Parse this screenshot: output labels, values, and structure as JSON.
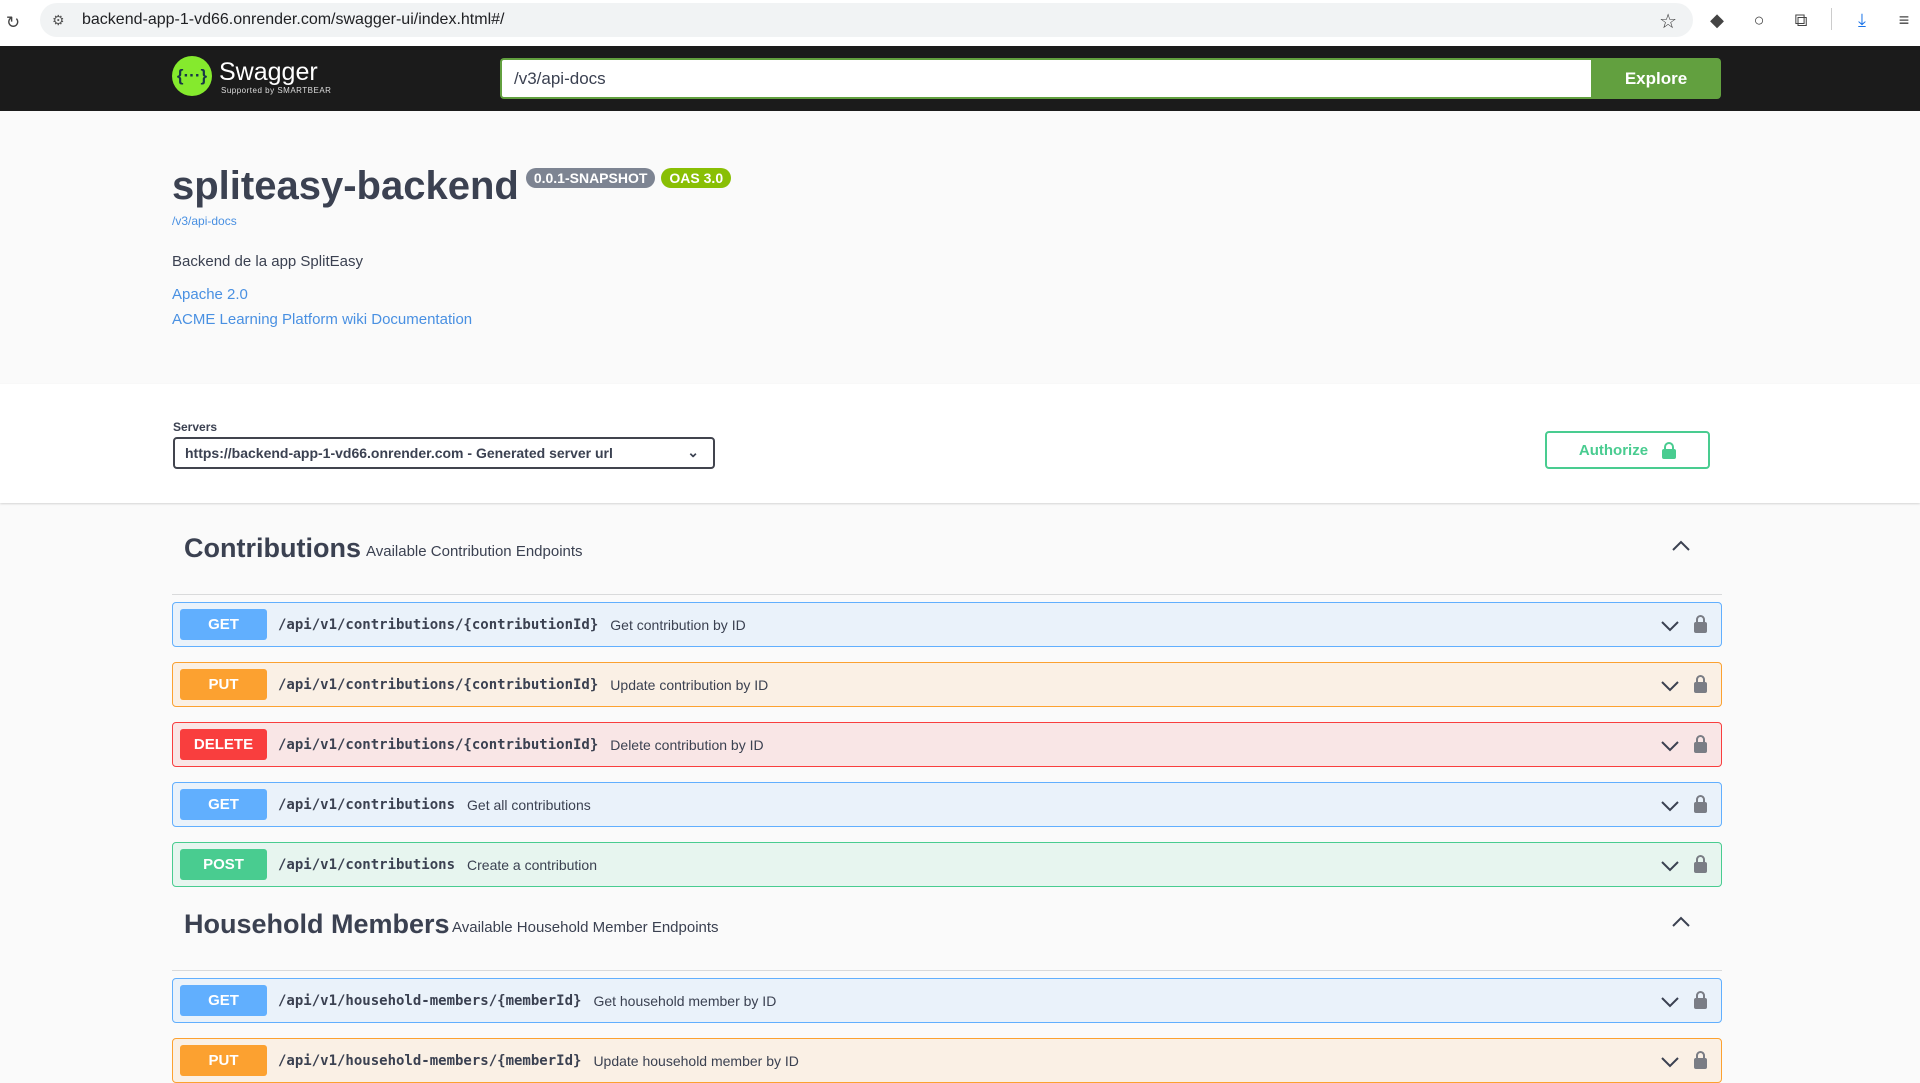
{
  "browser": {
    "url": "backend-app-1-vd66.onrender.com/swagger-ui/index.html#/"
  },
  "header": {
    "logo_title": "Swagger",
    "logo_sub": "Supported by SMARTBEAR",
    "search_value": "/v3/api-docs",
    "explore_label": "Explore"
  },
  "info": {
    "title": "spliteasy-backend",
    "version": "0.0.1-SNAPSHOT",
    "oas": "OAS 3.0",
    "api_link": "/v3/api-docs",
    "description": "Backend de la app SplitEasy",
    "license": "Apache 2.0",
    "docs_link": "ACME Learning Platform wiki Documentation"
  },
  "servers": {
    "label": "Servers",
    "selected": "https://backend-app-1-vd66.onrender.com - Generated server url",
    "authorize_label": "Authorize"
  },
  "sections": [
    {
      "title": "Contributions",
      "description": "Available Contribution Endpoints",
      "ops": [
        {
          "method": "GET",
          "path": "/api/v1/contributions/{contributionId}",
          "summary": "Get contribution by ID"
        },
        {
          "method": "PUT",
          "path": "/api/v1/contributions/{contributionId}",
          "summary": "Update contribution by ID"
        },
        {
          "method": "DELETE",
          "path": "/api/v1/contributions/{contributionId}",
          "summary": "Delete contribution by ID"
        },
        {
          "method": "GET",
          "path": "/api/v1/contributions",
          "summary": "Get all contributions"
        },
        {
          "method": "POST",
          "path": "/api/v1/contributions",
          "summary": "Create a contribution"
        }
      ]
    },
    {
      "title": "Household Members",
      "description": "Available Household Member Endpoints",
      "ops": [
        {
          "method": "GET",
          "path": "/api/v1/household-members/{memberId}",
          "summary": "Get household member by ID"
        },
        {
          "method": "PUT",
          "path": "/api/v1/household-members/{memberId}",
          "summary": "Update household member by ID"
        }
      ]
    }
  ],
  "colors": {
    "get": "#61affe",
    "put": "#fca130",
    "delete": "#f93e3e",
    "post": "#49cc90",
    "swagger_green": "#62a03f"
  }
}
